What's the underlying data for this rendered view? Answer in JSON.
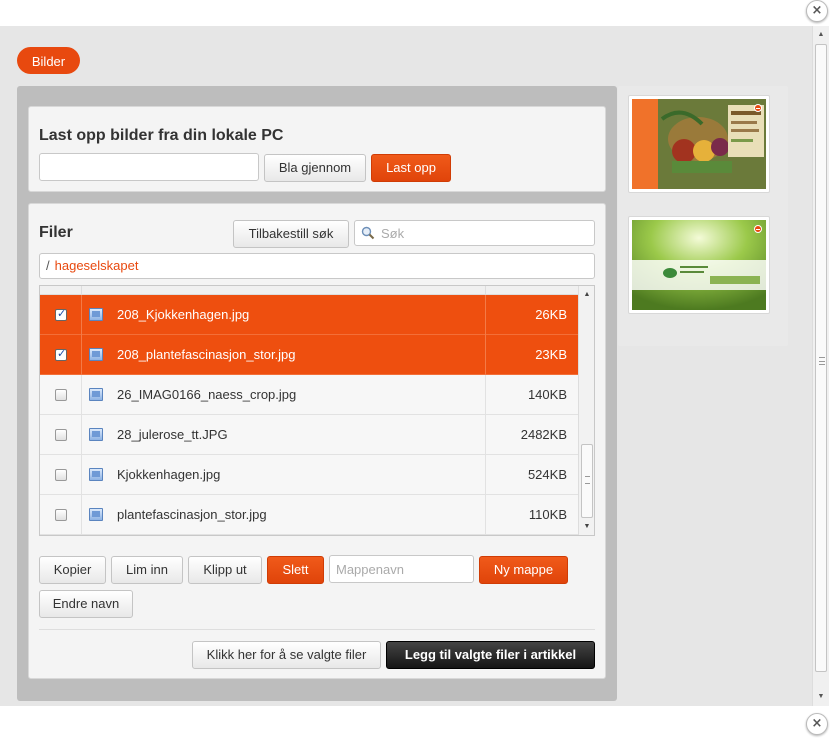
{
  "dialog": {
    "close_glyph": "×"
  },
  "tabs": {
    "active_label": "Bilder"
  },
  "upload": {
    "heading": "Last opp bilder fra din lokale PC",
    "file_value": "",
    "browse_label": "Bla gjennom",
    "upload_label": "Last opp"
  },
  "files": {
    "heading": "Filer",
    "reset_search_label": "Tilbakestill søk",
    "search_placeholder": "Søk",
    "path_separator": "/",
    "current_folder": "hageselskapet",
    "rows": [
      {
        "name": "208_Kjokkenhagen.jpg",
        "size": "26KB",
        "checked": true
      },
      {
        "name": "208_plantefascinasjon_stor.jpg",
        "size": "23KB",
        "checked": true
      },
      {
        "name": "26_IMAG0166_naess_crop.jpg",
        "size": "140KB",
        "checked": false
      },
      {
        "name": "28_julerose_tt.JPG",
        "size": "2482KB",
        "checked": false
      },
      {
        "name": "Kjokkenhagen.jpg",
        "size": "524KB",
        "checked": false
      },
      {
        "name": "plantefascinasjon_stor.jpg",
        "size": "110KB",
        "checked": false
      }
    ]
  },
  "actions": {
    "copy_label": "Kopier",
    "paste_label": "Lim inn",
    "cut_label": "Klipp ut",
    "delete_label": "Slett",
    "folder_name_placeholder": "Mappenavn",
    "new_folder_label": "Ny mappe",
    "rename_label": "Endre navn",
    "show_selected_label": "Klikk her for å se valgte filer",
    "add_to_article_label": "Legg til valgte filer i artikkel"
  },
  "side_thumbnails": [
    {
      "caption_lines": [
        "Fra",
        "Kjøkkenhagen",
        "til",
        "Forsk",
        "praktiske",
        "tips og råd"
      ]
    },
    {
      "caption_small": "Fascination of Plants Day",
      "caption_date": "May 18th 2012"
    }
  ],
  "colors": {
    "accent": "#E8490F",
    "selected_row": "#EE4F0F",
    "dark_button": "#1E1E1E"
  },
  "icons": [
    "close-icon",
    "search-icon",
    "image-file-icon",
    "remove-icon"
  ]
}
